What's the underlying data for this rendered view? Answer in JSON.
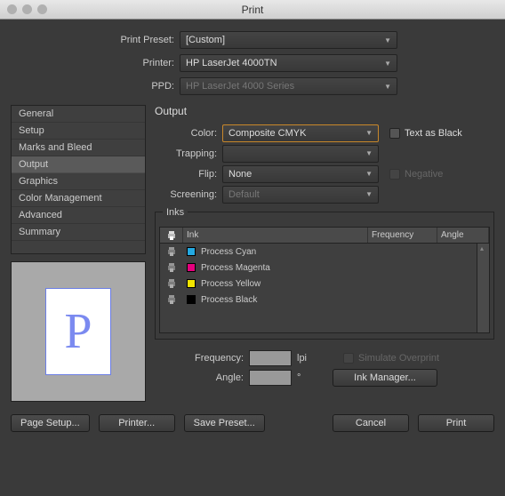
{
  "window": {
    "title": "Print"
  },
  "top": {
    "preset_label": "Print Preset:",
    "preset_value": "[Custom]",
    "printer_label": "Printer:",
    "printer_value": "HP LaserJet 4000TN",
    "ppd_label": "PPD:",
    "ppd_value": "HP LaserJet 4000 Series"
  },
  "sidebar": {
    "items": [
      "General",
      "Setup",
      "Marks and Bleed",
      "Output",
      "Graphics",
      "Color Management",
      "Advanced",
      "Summary"
    ],
    "selected": 3
  },
  "output": {
    "section": "Output",
    "color_label": "Color:",
    "color_value": "Composite CMYK",
    "text_as_black": "Text as Black",
    "trapping_label": "Trapping:",
    "trapping_value": "",
    "flip_label": "Flip:",
    "flip_value": "None",
    "negative_label": "Negative",
    "screening_label": "Screening:",
    "screening_value": "Default"
  },
  "inks": {
    "panel_title": "Inks",
    "head_ink": "Ink",
    "head_freq": "Frequency",
    "head_angle": "Angle",
    "rows": [
      {
        "name": "Process Cyan",
        "swatch": "#24a9e1"
      },
      {
        "name": "Process Magenta",
        "swatch": "#e5007e"
      },
      {
        "name": "Process Yellow",
        "swatch": "#f2e500"
      },
      {
        "name": "Process Black",
        "swatch": "#000000"
      }
    ]
  },
  "freq": {
    "frequency_label": "Frequency:",
    "frequency_unit": "lpi",
    "angle_label": "Angle:",
    "angle_unit": "°",
    "simulate_label": "Simulate Overprint",
    "ink_manager_btn": "Ink Manager..."
  },
  "buttons": {
    "page_setup": "Page Setup...",
    "printer": "Printer...",
    "save_preset": "Save Preset...",
    "cancel": "Cancel",
    "print": "Print"
  },
  "preview": {
    "glyph": "P"
  }
}
